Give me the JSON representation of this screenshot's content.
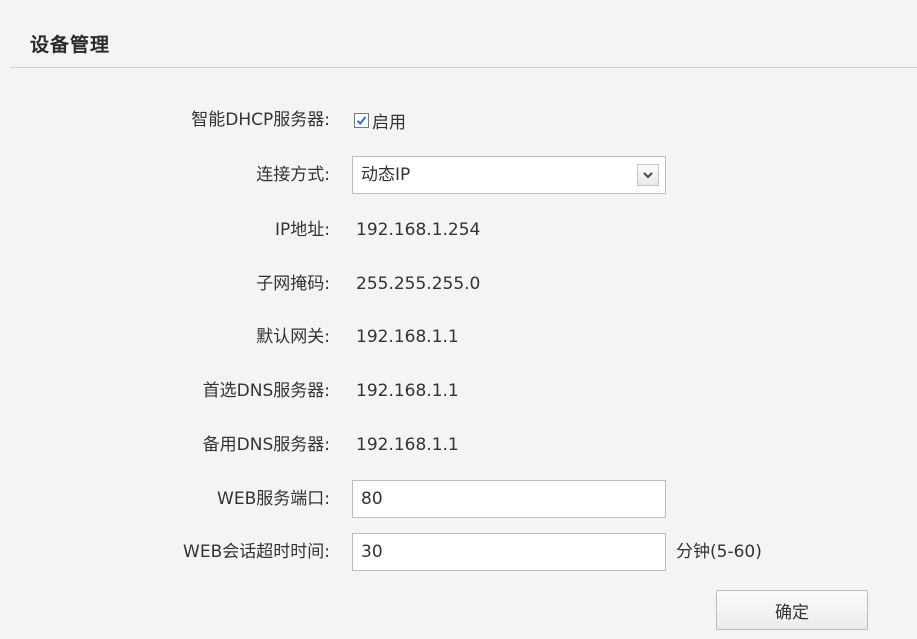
{
  "section_title": "设备管理",
  "dhcp": {
    "label": "智能DHCP服务器:",
    "checked": true,
    "checkbox_label": "启用"
  },
  "connection": {
    "label": "连接方式:",
    "selected": "动态IP"
  },
  "ip": {
    "label": "IP地址:",
    "value": "192.168.1.254"
  },
  "subnet": {
    "label": "子网掩码:",
    "value": "255.255.255.0"
  },
  "gateway": {
    "label": "默认网关:",
    "value": "192.168.1.1"
  },
  "dns_primary": {
    "label": "首选DNS服务器:",
    "value": "192.168.1.1"
  },
  "dns_secondary": {
    "label": "备用DNS服务器:",
    "value": "192.168.1.1"
  },
  "web_port": {
    "label": "WEB服务端口:",
    "value": "80"
  },
  "web_timeout": {
    "label": "WEB会话超时时间:",
    "value": "30",
    "suffix": "分钟(5-60)"
  },
  "confirm_label": "确定",
  "colors": {
    "checkbox_check": "#2a6fd1",
    "border": "#bdbdbd",
    "background": "#f4f4f4"
  }
}
